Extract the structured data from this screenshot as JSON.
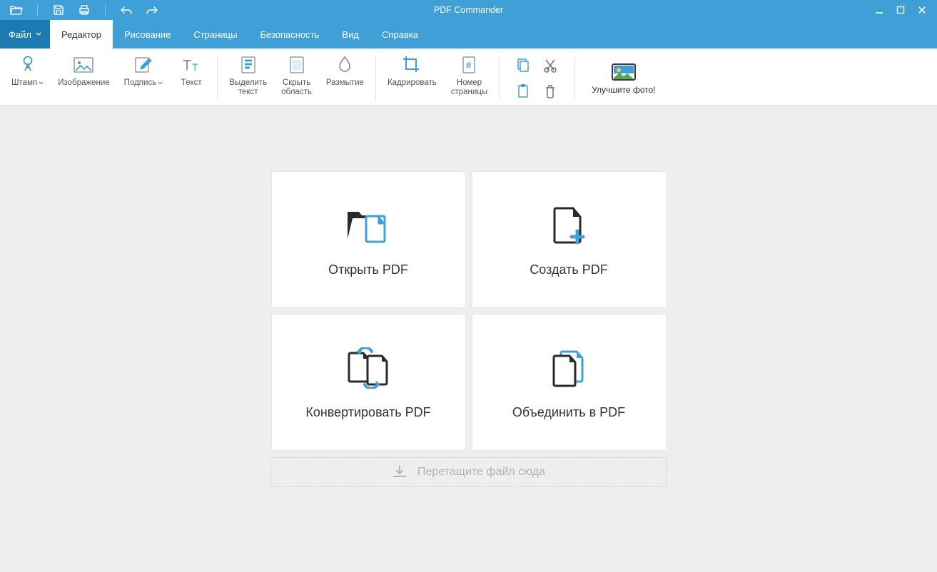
{
  "app": {
    "title": "PDF Commander"
  },
  "menubar": {
    "file": "Файл",
    "items": [
      "Редактор",
      "Рисование",
      "Страницы",
      "Безопасность",
      "Вид",
      "Справка"
    ],
    "active_index": 0
  },
  "ribbon": {
    "stamp": "Штамп",
    "image": "Изображение",
    "signature": "Подпись",
    "text": "Текст",
    "highlight": "Выделить\nтекст",
    "hide_area": "Скрыть\nобласть",
    "blur": "Размытие",
    "crop": "Кадрировать",
    "page_number": "Номер\nстраницы",
    "enhance_photo": "Улучшите фото!"
  },
  "start": {
    "open_pdf": "Открыть PDF",
    "create_pdf": "Создать PDF",
    "convert_pdf": "Конвертировать PDF",
    "merge_pdf": "Объединить в PDF",
    "drop_here": "Перетащите файл сюда"
  }
}
